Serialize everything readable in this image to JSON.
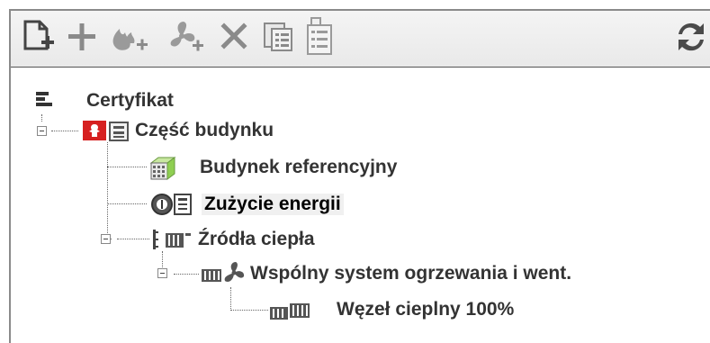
{
  "toolbar": {
    "buttons": [
      {
        "name": "new-document-button",
        "icon": "new-document-icon"
      },
      {
        "name": "add-button",
        "icon": "plus-icon"
      },
      {
        "name": "add-heat-source-button",
        "icon": "flame-plus-icon"
      },
      {
        "name": "add-ventilation-button",
        "icon": "fan-plus-icon"
      },
      {
        "name": "delete-button",
        "icon": "close-icon"
      },
      {
        "name": "copy-button",
        "icon": "copy-icon"
      },
      {
        "name": "form-button",
        "icon": "form-icon"
      },
      {
        "name": "refresh-button",
        "icon": "refresh-icon"
      }
    ]
  },
  "tree": {
    "root": {
      "label": "Certyfikat",
      "icon": "list-icon"
    },
    "building_part": {
      "label": "Część budynku",
      "icon": "building-part-icon"
    },
    "reference_building": {
      "label": "Budynek referencyjny",
      "icon": "cube-building-icon"
    },
    "energy_use": {
      "label": "Zużycie energii",
      "icon": "energy-meter-icon",
      "selected": true
    },
    "heat_sources": {
      "label": "Źródła ciepła",
      "icon": "radiator-icon"
    },
    "shared_system": {
      "label": "Wspólny system ogrzewania i went.",
      "icon": "radiator-fan-icon"
    },
    "heat_node": {
      "label": "Węzeł cieplny 100%",
      "icon": "radiator-pair-icon"
    }
  },
  "colors": {
    "accent_red": "#d62020",
    "icon_gray": "#4a4a4a",
    "toolbar_icon": "#7a7a7a",
    "cube_green": "#8fcf52"
  }
}
